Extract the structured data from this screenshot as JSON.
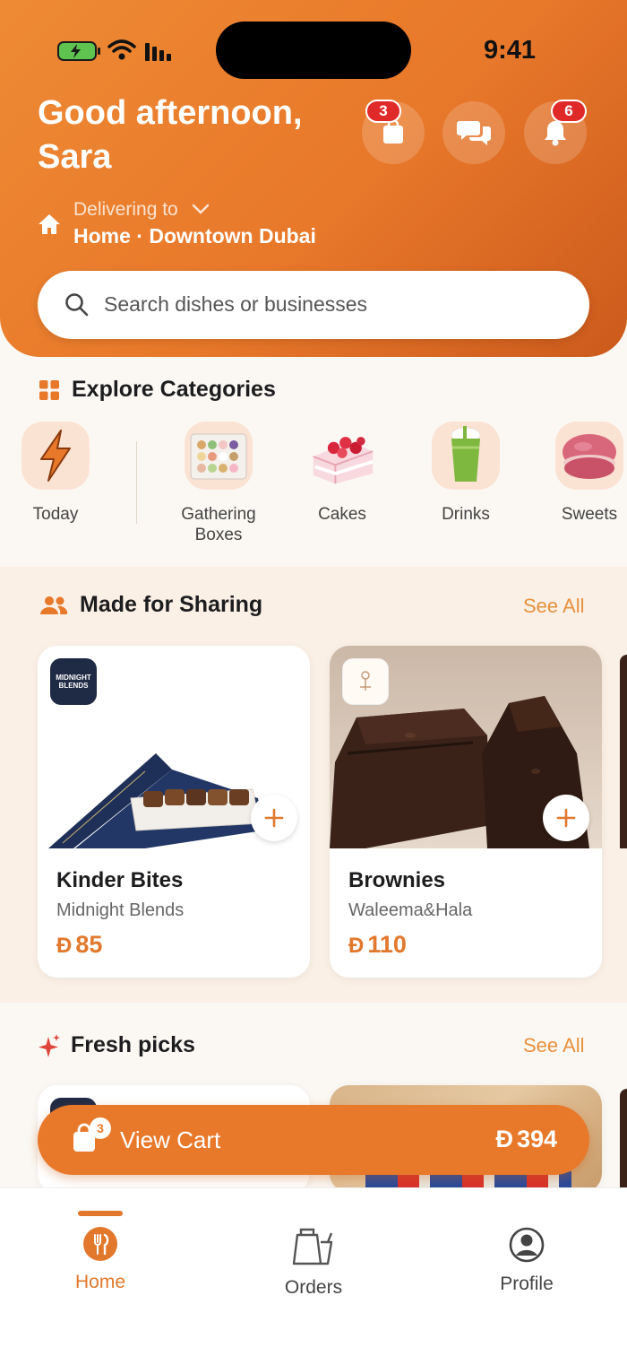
{
  "status_bar": {
    "time": "9:41"
  },
  "header": {
    "greeting": "Good afternoon, Sara",
    "basket_badge": "3",
    "notifications_badge": "6",
    "delivering_label": "Delivering to",
    "address": "Home · Downtown Dubai"
  },
  "search": {
    "placeholder": "Search dishes or businesses"
  },
  "categories": {
    "title": "Explore Categories",
    "items": [
      {
        "label": "Today",
        "icon": "lightning-icon"
      },
      {
        "label": "Gathering Boxes",
        "icon": "gift-box-icon"
      },
      {
        "label": "Cakes",
        "icon": "cake-icon"
      },
      {
        "label": "Drinks",
        "icon": "drink-icon"
      },
      {
        "label": "Sweets",
        "icon": "macaron-icon"
      }
    ]
  },
  "sharing": {
    "title": "Made for Sharing",
    "see_all": "See All",
    "items": [
      {
        "name": "Kinder Bites",
        "business": "Midnight Blends",
        "currency": "Đ",
        "price": "85",
        "logo_text": "MIDNIGHT BLENDS"
      },
      {
        "name": "Brownies",
        "business": "Waleema&Hala",
        "currency": "Đ",
        "price": "110",
        "logo_text": ""
      }
    ]
  },
  "fresh": {
    "title": "Fresh picks",
    "see_all": "See All"
  },
  "cart": {
    "label": "View Cart",
    "count": "3",
    "currency": "Đ",
    "total": "394"
  },
  "tabs": [
    {
      "label": "Home",
      "active": true
    },
    {
      "label": "Orders",
      "active": false
    },
    {
      "label": "Profile",
      "active": false
    }
  ],
  "colors": {
    "accent": "#e8782a",
    "badge": "#e02a2a",
    "background": "#fbf8f3"
  }
}
